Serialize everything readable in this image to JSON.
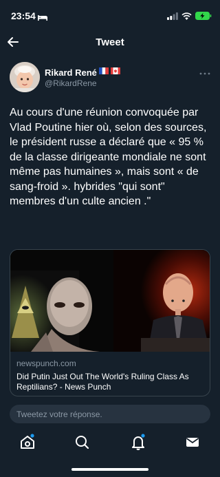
{
  "status_bar": {
    "time": "23:54",
    "battery_color": "#32d74b"
  },
  "header": {
    "title": "Tweet"
  },
  "tweet": {
    "author_name": "Rikard René",
    "author_handle": "@RikardRene",
    "author_flags": [
      "flag-france-icon",
      "flag-canada-icon"
    ],
    "text": "Au cours d'une réunion convoquée par Vlad Poutine hier où, selon des sources, le président russe a déclaré que « 95 % de la classe dirigeante mondiale ne sont même pas humaines », mais sont « de sang-froid ». hybrides \"qui sont\" membres d'un culte ancien .\""
  },
  "card": {
    "domain": "newspunch.com",
    "title": "Did Putin Just Out The World's Ruling Class As Reptilians? - News Punch"
  },
  "reply": {
    "placeholder": "Tweetez votre réponse."
  },
  "tabbar": {
    "items": [
      "home-icon",
      "search-icon",
      "notifications-icon",
      "messages-icon"
    ],
    "notification_dot_color": "#1d9bf0"
  },
  "colors": {
    "background": "#15202b",
    "secondary_text": "#8b98a5",
    "border": "#38444d",
    "accent": "#1d9bf0"
  }
}
